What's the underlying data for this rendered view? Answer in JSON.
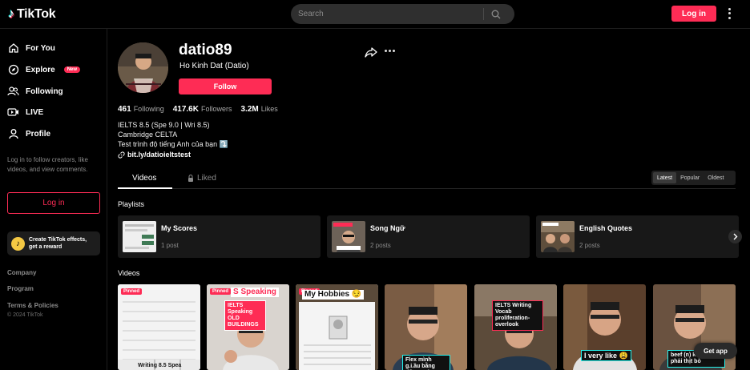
{
  "header": {
    "logo_text": "TikTok",
    "search_placeholder": "Search",
    "login_label": "Log in"
  },
  "sidebar": {
    "items": [
      {
        "label": "For You",
        "icon": "home-icon"
      },
      {
        "label": "Explore",
        "icon": "compass-icon",
        "badge": "New"
      },
      {
        "label": "Following",
        "icon": "users-icon"
      },
      {
        "label": "LIVE",
        "icon": "live-icon"
      },
      {
        "label": "Profile",
        "icon": "user-icon"
      }
    ],
    "login_note": "Log in to follow creators, like videos, and view comments.",
    "login_button": "Log in",
    "effects_line1": "Create TikTok effects,",
    "effects_line2": "get a reward",
    "footer": [
      "Company",
      "Program",
      "Terms & Policies"
    ],
    "copyright": "© 2024 TikTok"
  },
  "profile": {
    "username": "datio89",
    "nickname": "Ho Kinh Dat (Datio)",
    "follow_label": "Follow",
    "stats": {
      "following_count": "461",
      "following_label": "Following",
      "followers_count": "417.6K",
      "followers_label": "Followers",
      "likes_count": "3.2M",
      "likes_label": "Likes"
    },
    "bio": [
      "IELTS 8.5 (Spe 9.0 | Wri 8.5)",
      "Cambridge CELTA",
      "Test trình độ tiếng Anh của bạn ⤵️"
    ],
    "link": "bit.ly/datioieltstest"
  },
  "tabs": {
    "videos": "Videos",
    "liked": "Liked",
    "sort": [
      "Latest",
      "Popular",
      "Oldest"
    ]
  },
  "playlists": {
    "label": "Playlists",
    "items": [
      {
        "title": "My Scores",
        "count": "1 post"
      },
      {
        "title": "Song Ngữ",
        "count": "2 posts"
      },
      {
        "title": "English Quotes",
        "count": "2 posts"
      }
    ]
  },
  "videos": {
    "label": "Videos",
    "pinned_label": "Pinned",
    "captions": {
      "v1_bottom": "Writing 8.5 Spea",
      "v2_top": "S Speaking",
      "v2_box": "IELTS Speaking OLD BUILDINGS",
      "v3_top": "My Hobbies 😏",
      "v4_box": "Flex mình g.i.ầu bằng tiếng Anh",
      "v5_box": "IELTS Writing Vocab proliferation- overlook",
      "v6_box": "I very like 😩",
      "v7_box": "beef (n) không phải thịt bò"
    }
  },
  "get_app": "Get app",
  "colors": {
    "brand": "#fe2c55",
    "background": "#000000",
    "panel": "#181818"
  }
}
